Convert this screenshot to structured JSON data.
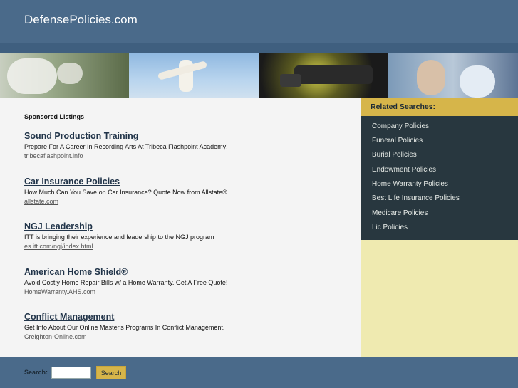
{
  "site": {
    "title": "DefensePolicies.com"
  },
  "main": {
    "sponsored_heading": "Sponsored Listings",
    "listings": [
      {
        "title": "Sound Production Training",
        "description": "Prepare For A Career In Recording Arts At Tribeca Flashpoint Academy!",
        "url": "tribecaflashpoint.info"
      },
      {
        "title": "Car Insurance Policies",
        "description": "How Much Can You Save on Car Insurance? Quote Now from Allstate®",
        "url": "allstate.com"
      },
      {
        "title": "NGJ Leadership",
        "description": "ITT is bringing their experience and leadership to the NGJ program",
        "url": "es.itt.com/ngj/index.html"
      },
      {
        "title": "American Home Shield®",
        "description": "Avoid Costly Home Repair Bills w/ a Home Warranty. Get A Free Quote!",
        "url": "HomeWarranty.AHS.com"
      },
      {
        "title": "Conflict Management",
        "description": "Get Info About Our Online Master's Programs In Conflict Management.",
        "url": "Creighton-Online.com"
      }
    ]
  },
  "sidebar": {
    "related_title": "Related Searches:",
    "items": [
      {
        "label": "Company Policies"
      },
      {
        "label": "Funeral Policies"
      },
      {
        "label": "Burial Policies"
      },
      {
        "label": "Endowment Policies"
      },
      {
        "label": "Home Warranty Policies"
      },
      {
        "label": "Best Life Insurance Policies"
      },
      {
        "label": "Medicare Policies"
      },
      {
        "label": "Lic Policies"
      }
    ]
  },
  "footer": {
    "search_label": "Search:",
    "search_value": "",
    "search_button": "Search"
  },
  "colors": {
    "header": "#4a6a8a",
    "accent": "#d6b54a",
    "sidebar_dark": "#28373f",
    "sidebar_light": "#efeab0"
  }
}
